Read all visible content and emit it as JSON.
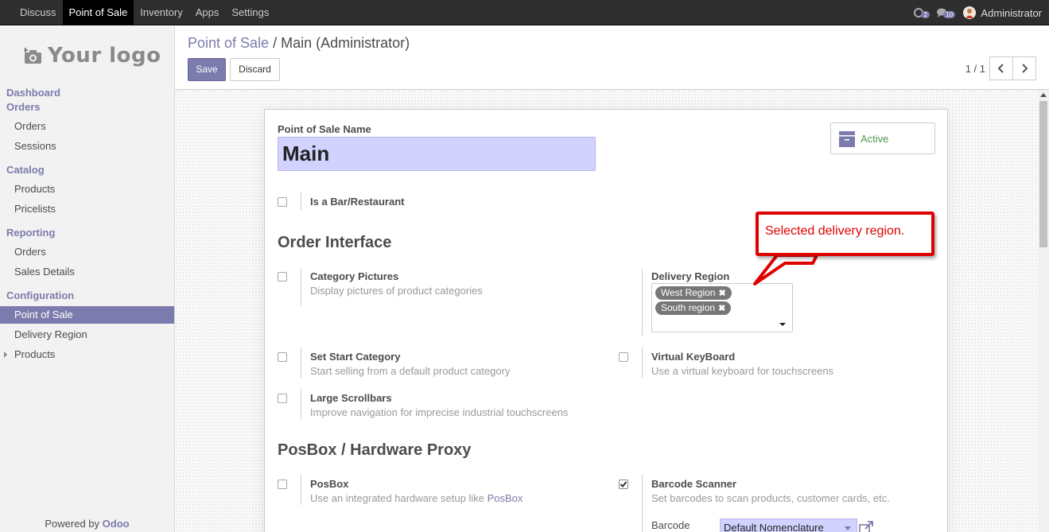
{
  "topbar": {
    "menu": [
      "Discuss",
      "Point of Sale",
      "Inventory",
      "Apps",
      "Settings"
    ],
    "active_menu": "Point of Sale",
    "activity_count": "2",
    "messages_count": "10",
    "user": "Administrator"
  },
  "sidebar": {
    "logo_text": "Your logo",
    "dashboard": "Dashboard",
    "orders_section": "Orders",
    "orders_items": [
      "Orders",
      "Sessions"
    ],
    "catalog_section": "Catalog",
    "catalog_items": [
      "Products",
      "Pricelists"
    ],
    "reporting_section": "Reporting",
    "reporting_items": [
      "Orders",
      "Sales Details"
    ],
    "configuration_section": "Configuration",
    "configuration_items": [
      "Point of Sale",
      "Delivery Region",
      "Products"
    ],
    "powered_by": "Powered by",
    "powered_brand": "Odoo"
  },
  "control_panel": {
    "breadcrumb_parent": "Point of Sale",
    "breadcrumb_separator": "/",
    "breadcrumb_current": "Main (Administrator)",
    "save_label": "Save",
    "discard_label": "Discard",
    "pager": "1 / 1"
  },
  "form": {
    "name_label": "Point of Sale Name",
    "name_value": "Main",
    "active_label": "Active",
    "bar_restaurant": "Is a Bar/Restaurant",
    "order_interface_title": "Order Interface",
    "category_pictures_title": "Category Pictures",
    "category_pictures_desc": "Display pictures of product categories",
    "delivery_region_label": "Delivery Region",
    "delivery_region_tags": [
      "West Region",
      "South region"
    ],
    "set_start_category_title": "Set Start Category",
    "set_start_category_desc": "Start selling from a default product category",
    "virtual_keyboard_title": "Virtual KeyBoard",
    "virtual_keyboard_desc": "Use a virtual keyboard for touchscreens",
    "large_scrollbars_title": "Large Scrollbars",
    "large_scrollbars_desc": "Improve navigation for imprecise industrial touchscreens",
    "posbox_section_title": "PosBox / Hardware Proxy",
    "posbox_title": "PosBox",
    "posbox_desc_prefix": "Use an integrated hardware setup like",
    "posbox_desc_link": "PosBox",
    "barcode_scanner_title": "Barcode Scanner",
    "barcode_scanner_checked": true,
    "barcode_scanner_desc": "Set barcodes to scan products, customer cards, etc.",
    "barcode_label": "Barcode",
    "barcode_value": "Default Nomenclature"
  },
  "annotation": {
    "text": "Selected delivery region."
  },
  "colors": {
    "accent": "#7c7bad",
    "callout": "#e00000",
    "active_green": "#4c9a4c",
    "input_bg": "#d2d2ff"
  }
}
